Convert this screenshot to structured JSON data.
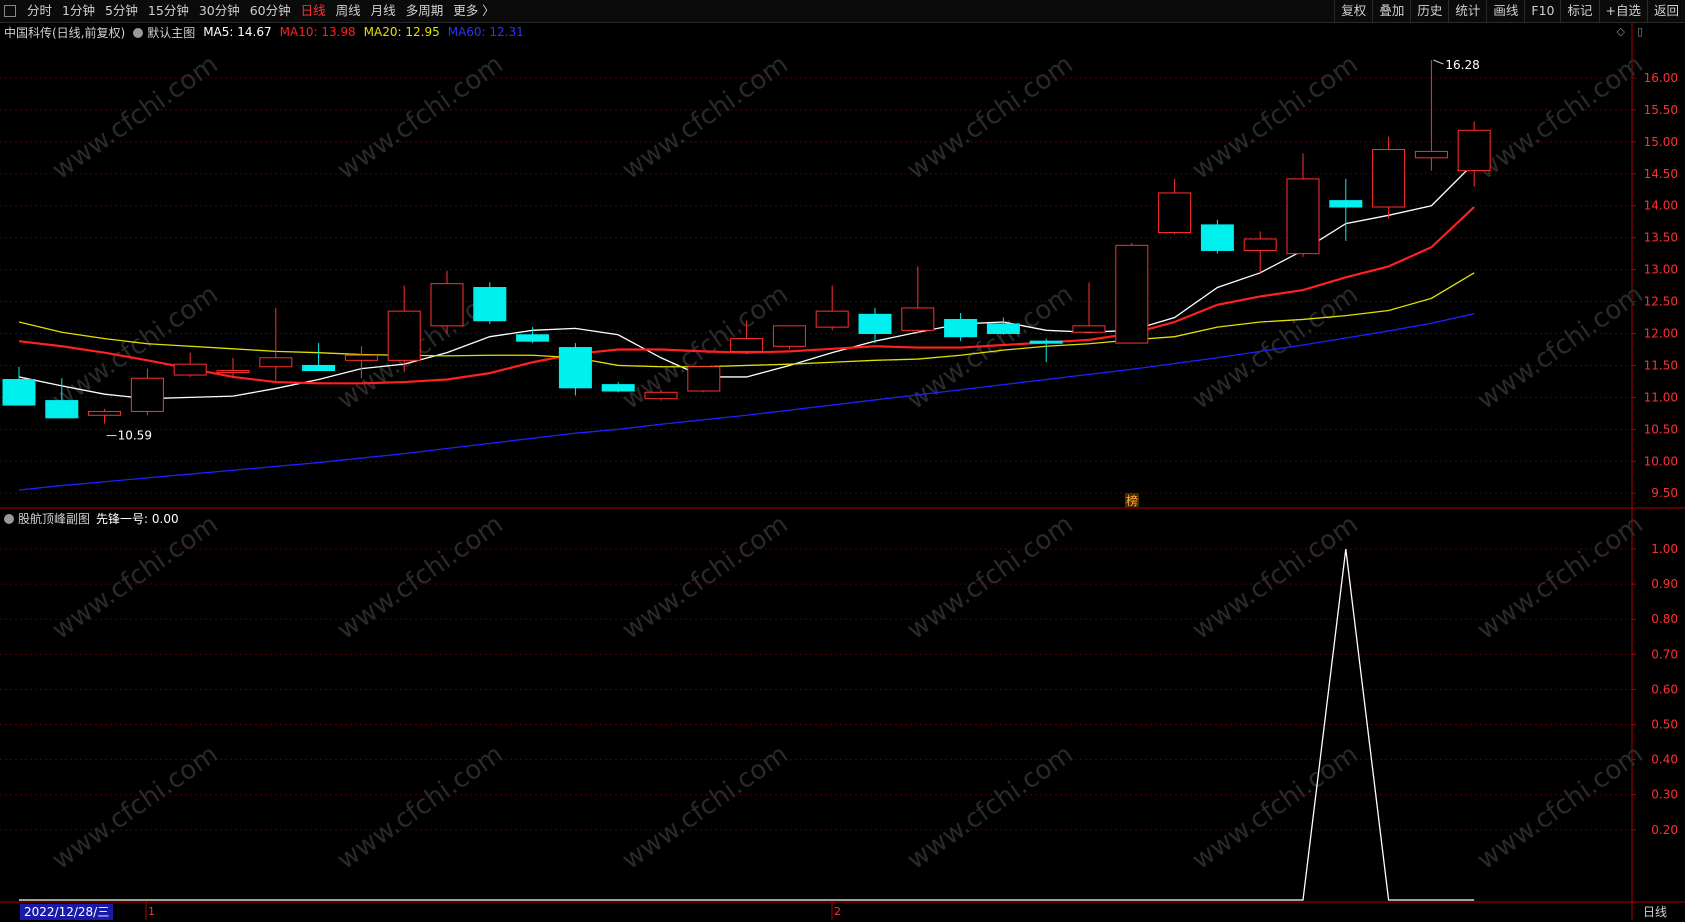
{
  "toolbar": {
    "periods": [
      "分时",
      "1分钟",
      "5分钟",
      "15分钟",
      "30分钟",
      "60分钟",
      "日线",
      "周线",
      "月线",
      "多周期",
      "更多 〉"
    ],
    "active_period": "日线",
    "right_buttons": [
      "复权",
      "叠加",
      "历史",
      "统计",
      "画线",
      "F10",
      "标记",
      "+自选",
      "返回"
    ]
  },
  "main_header": {
    "stock": "中国科传(日线,前复权)",
    "chart_name": "默认主图",
    "ma5": "MA5: 14.67",
    "ma10": "MA10: 13.98",
    "ma20": "MA20: 12.95",
    "ma60": "MA60: 12.31"
  },
  "sub_header": {
    "chart_name": "股航顶峰副图",
    "indicator": "先锋一号: 0.00"
  },
  "annotations": {
    "high": "16.28",
    "low": "10.59",
    "flag": "榜"
  },
  "status": {
    "date": "2022/12/28/三",
    "mark1": "1",
    "mark2": "2",
    "period": "日线"
  },
  "colors": {
    "up": "#ff3030",
    "down": "#00f0f0",
    "ma5": "#ffffff",
    "ma10": "#ff2020",
    "ma20": "#e0e000",
    "ma60": "#2020ff",
    "axis": "#b00000"
  },
  "chart_data": [
    {
      "type": "candlestick",
      "title": "默认主图",
      "ylim": [
        9.3,
        16.5
      ],
      "yticks": [
        9.5,
        10.0,
        10.5,
        11.0,
        11.5,
        12.0,
        12.5,
        13.0,
        13.5,
        14.0,
        14.5,
        15.0,
        15.5,
        16.0
      ],
      "candles": [
        {
          "o": 11.28,
          "h": 11.48,
          "l": 10.88,
          "c": 10.88
        },
        {
          "o": 10.95,
          "h": 11.3,
          "l": 10.68,
          "c": 10.68
        },
        {
          "o": 10.72,
          "h": 10.82,
          "l": 10.59,
          "c": 10.78
        },
        {
          "o": 10.78,
          "h": 11.45,
          "l": 10.72,
          "c": 11.3
        },
        {
          "o": 11.35,
          "h": 11.7,
          "l": 11.32,
          "c": 11.52
        },
        {
          "o": 11.4,
          "h": 11.62,
          "l": 11.3,
          "c": 11.42
        },
        {
          "o": 11.48,
          "h": 12.4,
          "l": 11.26,
          "c": 11.62
        },
        {
          "o": 11.5,
          "h": 11.85,
          "l": 11.42,
          "c": 11.42
        },
        {
          "o": 11.58,
          "h": 11.8,
          "l": 11.3,
          "c": 11.66
        },
        {
          "o": 11.58,
          "h": 12.75,
          "l": 11.4,
          "c": 12.35
        },
        {
          "o": 12.12,
          "h": 12.98,
          "l": 12.0,
          "c": 12.78
        },
        {
          "o": 12.72,
          "h": 12.8,
          "l": 12.15,
          "c": 12.2
        },
        {
          "o": 11.98,
          "h": 12.1,
          "l": 11.85,
          "c": 11.88
        },
        {
          "o": 11.78,
          "h": 11.85,
          "l": 11.03,
          "c": 11.15
        },
        {
          "o": 11.2,
          "h": 11.24,
          "l": 11.08,
          "c": 11.1
        },
        {
          "o": 10.98,
          "h": 11.12,
          "l": 10.95,
          "c": 11.08
        },
        {
          "o": 11.1,
          "h": 11.5,
          "l": 11.08,
          "c": 11.48
        },
        {
          "o": 11.72,
          "h": 12.2,
          "l": 11.68,
          "c": 11.92
        },
        {
          "o": 11.8,
          "h": 12.12,
          "l": 11.75,
          "c": 12.12
        },
        {
          "o": 12.1,
          "h": 12.75,
          "l": 12.05,
          "c": 12.35
        },
        {
          "o": 12.3,
          "h": 12.4,
          "l": 11.85,
          "c": 12.0
        },
        {
          "o": 12.05,
          "h": 13.05,
          "l": 12.0,
          "c": 12.4
        },
        {
          "o": 12.22,
          "h": 12.32,
          "l": 11.88,
          "c": 11.95
        },
        {
          "o": 12.15,
          "h": 12.25,
          "l": 11.98,
          "c": 12.0
        },
        {
          "o": 11.88,
          "h": 11.92,
          "l": 11.55,
          "c": 11.86
        },
        {
          "o": 12.02,
          "h": 12.8,
          "l": 12.0,
          "c": 12.12
        },
        {
          "o": 11.85,
          "h": 13.42,
          "l": 11.85,
          "c": 13.38
        },
        {
          "o": 13.58,
          "h": 14.42,
          "l": 13.55,
          "c": 14.2
        },
        {
          "o": 13.7,
          "h": 13.78,
          "l": 13.25,
          "c": 13.3
        },
        {
          "o": 13.3,
          "h": 13.6,
          "l": 12.95,
          "c": 13.48
        },
        {
          "o": 13.25,
          "h": 14.82,
          "l": 13.2,
          "c": 14.42
        },
        {
          "o": 14.08,
          "h": 14.42,
          "l": 13.45,
          "c": 13.98
        },
        {
          "o": 13.98,
          "h": 15.08,
          "l": 13.8,
          "c": 14.88
        },
        {
          "o": 14.75,
          "h": 16.28,
          "l": 14.55,
          "c": 14.85
        },
        {
          "o": 14.55,
          "h": 15.32,
          "l": 14.3,
          "c": 15.18
        }
      ],
      "series": [
        {
          "name": "MA5",
          "values": [
            11.32,
            11.18,
            11.05,
            10.98,
            11.0,
            11.02,
            11.14,
            11.28,
            11.45,
            11.52,
            11.7,
            11.95,
            12.05,
            12.08,
            11.98,
            11.62,
            11.32,
            11.32,
            11.5,
            11.7,
            11.88,
            12.02,
            12.15,
            12.18,
            12.05,
            12.02,
            12.05,
            12.25,
            12.72,
            12.95,
            13.3,
            13.72,
            13.85,
            14.0,
            14.67
          ]
        },
        {
          "name": "MA10",
          "values": [
            11.88,
            11.8,
            11.7,
            11.58,
            11.45,
            11.32,
            11.24,
            11.22,
            11.22,
            11.24,
            11.28,
            11.38,
            11.55,
            11.68,
            11.75,
            11.75,
            11.72,
            11.7,
            11.72,
            11.76,
            11.8,
            11.78,
            11.78,
            11.82,
            11.86,
            11.9,
            12.0,
            12.18,
            12.45,
            12.58,
            12.68,
            12.88,
            13.05,
            13.35,
            13.98
          ]
        },
        {
          "name": "MA20",
          "values": [
            12.18,
            12.02,
            11.92,
            11.84,
            11.8,
            11.76,
            11.72,
            11.7,
            11.67,
            11.66,
            11.65,
            11.66,
            11.66,
            11.62,
            11.5,
            11.48,
            11.48,
            11.5,
            11.52,
            11.55,
            11.58,
            11.6,
            11.66,
            11.74,
            11.8,
            11.84,
            11.9,
            11.95,
            12.1,
            12.18,
            12.22,
            12.28,
            12.36,
            12.55,
            12.95
          ]
        },
        {
          "name": "MA60",
          "values": [
            9.55,
            9.62,
            9.68,
            9.74,
            9.8,
            9.86,
            9.92,
            9.98,
            10.05,
            10.12,
            10.2,
            10.28,
            10.36,
            10.44,
            10.5,
            10.58,
            10.65,
            10.72,
            10.8,
            10.88,
            10.96,
            11.04,
            11.12,
            11.2,
            11.28,
            11.36,
            11.44,
            11.53,
            11.62,
            11.72,
            11.82,
            11.93,
            12.04,
            12.16,
            12.31
          ]
        }
      ]
    },
    {
      "type": "line",
      "title": "股航顶峰副图",
      "ylim": [
        0.0,
        1.06
      ],
      "yticks": [
        0.2,
        0.3,
        0.4,
        0.5,
        0.6,
        0.7,
        0.8,
        0.9,
        1.0
      ],
      "series": [
        {
          "name": "先锋一号",
          "values": [
            0,
            0,
            0,
            0,
            0,
            0,
            0,
            0,
            0,
            0,
            0,
            0,
            0,
            0,
            0,
            0,
            0,
            0,
            0,
            0,
            0,
            0,
            0,
            0,
            0,
            0,
            0,
            0,
            0,
            0,
            0,
            1,
            0,
            0,
            0
          ]
        }
      ]
    }
  ]
}
